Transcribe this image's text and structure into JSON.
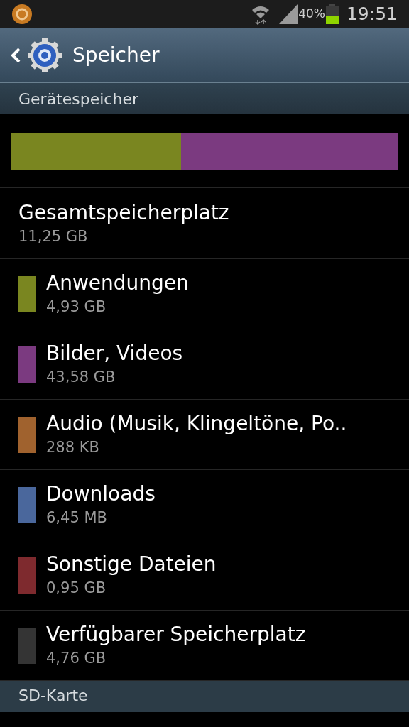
{
  "status_bar": {
    "battery": "40%",
    "time": "19:51"
  },
  "action_bar": {
    "title": "Speicher"
  },
  "sections": [
    {
      "title": "Gerätespeicher"
    },
    {
      "title": "SD-Karte"
    }
  ],
  "total": {
    "label": "Gesamtspeicherplatz",
    "value": "11,25 GB"
  },
  "items": [
    {
      "label": "Anwendungen",
      "value": "4,93 GB",
      "color": "#7a8620",
      "level": 0.44
    },
    {
      "label": "Bilder, Videos",
      "value": "43,58 GB",
      "color": "#7b3a80",
      "level": 0.56
    },
    {
      "label": "Audio (Musik, Klingeltöne, Po..",
      "value": "288 KB",
      "color": "#a0622e"
    },
    {
      "label": "Downloads",
      "value": "6,45 MB",
      "color": "#4a679c"
    },
    {
      "label": "Sonstige Dateien",
      "value": "0,95 GB",
      "color": "#7e2a2e"
    },
    {
      "label": "Verfügbarer Speicherplatz",
      "value": "4,76 GB",
      "color": "#343434"
    }
  ]
}
